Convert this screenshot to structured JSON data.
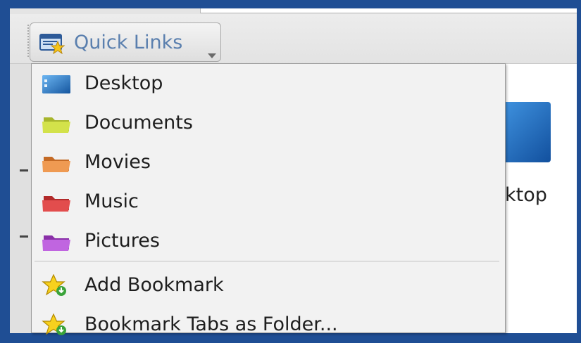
{
  "toolbar": {
    "quick_links": {
      "label": "Quick Links",
      "icon": "bookmark-folder-icon"
    }
  },
  "menu": {
    "items": [
      {
        "label": "Desktop",
        "icon": "desktop-folder-icon",
        "color": "#2a7ed0"
      },
      {
        "label": "Documents",
        "icon": "documents-folder-icon",
        "color": "#c9d83a"
      },
      {
        "label": "Movies",
        "icon": "movies-folder-icon",
        "color": "#e88a3c"
      },
      {
        "label": "Music",
        "icon": "music-folder-icon",
        "color": "#d93a3a"
      },
      {
        "label": "Pictures",
        "icon": "pictures-folder-icon",
        "color": "#b04ad0"
      }
    ],
    "actions": [
      {
        "label": "Add Bookmark",
        "icon": "add-bookmark-star-icon"
      },
      {
        "label": "Bookmark Tabs as Folder...",
        "icon": "bookmark-tabs-star-icon"
      }
    ]
  },
  "background": {
    "desktop_label_fragment": "ktop"
  },
  "colors": {
    "window_border": "#1f4e94",
    "menu_background": "#f2f2f2",
    "button_text": "#5a7fae"
  }
}
